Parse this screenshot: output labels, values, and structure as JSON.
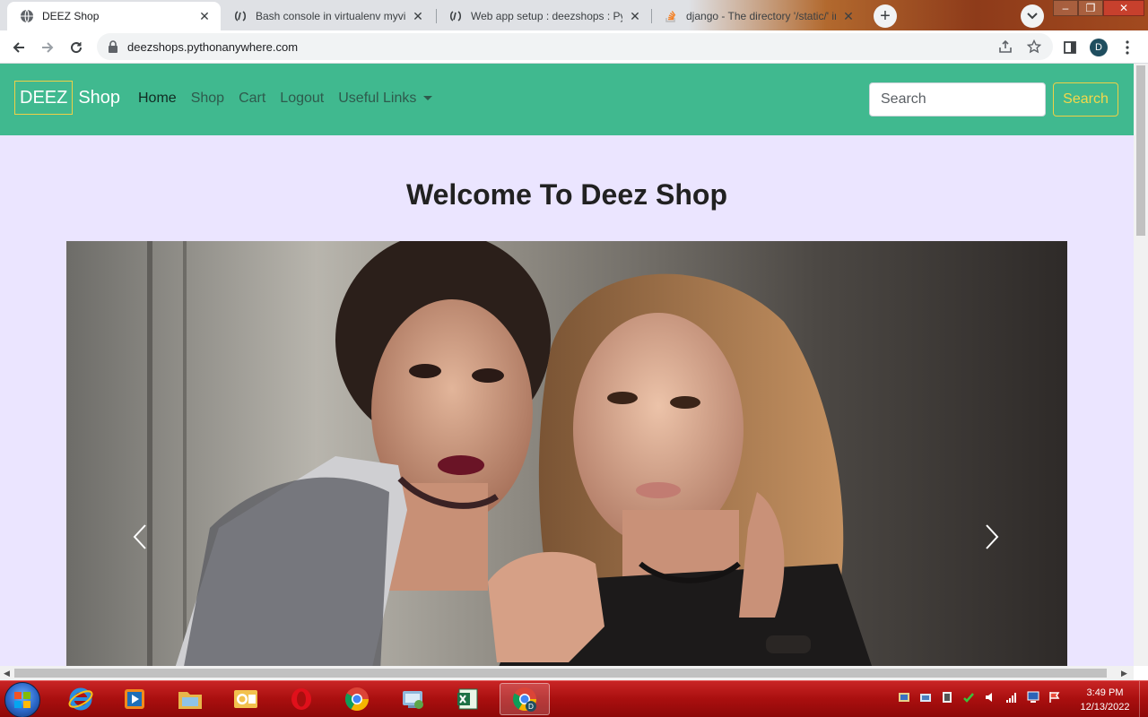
{
  "browser": {
    "tabs": [
      {
        "title": "DEEZ Shop",
        "active": true,
        "icon": "globe-icon"
      },
      {
        "title": "Bash console in virtualenv myvirt",
        "active": false,
        "icon": "pythonanywhere-icon"
      },
      {
        "title": "Web app setup : deezshops : Pyth",
        "active": false,
        "icon": "pythonanywhere-icon"
      },
      {
        "title": "django - The directory '/static/' in",
        "active": false,
        "icon": "stackoverflow-icon"
      }
    ],
    "url": "deezshops.pythonanywhere.com",
    "profile_initial": "D",
    "window_controls": {
      "minimize": "–",
      "maximize": "❐",
      "close": "✕"
    }
  },
  "site": {
    "brand": {
      "boxed": "DEEZ",
      "rest": "Shop"
    },
    "nav": {
      "home": "Home",
      "shop": "Shop",
      "cart": "Cart",
      "logout": "Logout",
      "useful_links": "Useful Links"
    },
    "search": {
      "placeholder": "Search",
      "button": "Search"
    },
    "welcome": "Welcome To Deez Shop",
    "carousel": {
      "prev_icon": "chevron-left-icon",
      "next_icon": "chevron-right-icon"
    }
  },
  "colors": {
    "navbar": "#40b98f",
    "accent_yellow": "#f0d045",
    "page_bg": "#ebe5ff",
    "taskbar": "#a90f0f"
  },
  "taskbar": {
    "apps": [
      "internet-explorer-icon",
      "media-player-icon",
      "file-explorer-icon",
      "outlook-icon",
      "opera-icon",
      "chrome-icon",
      "control-panel-icon",
      "excel-icon",
      "chrome-profile-icon"
    ],
    "time": "3:49 PM",
    "date": "12/13/2022"
  }
}
